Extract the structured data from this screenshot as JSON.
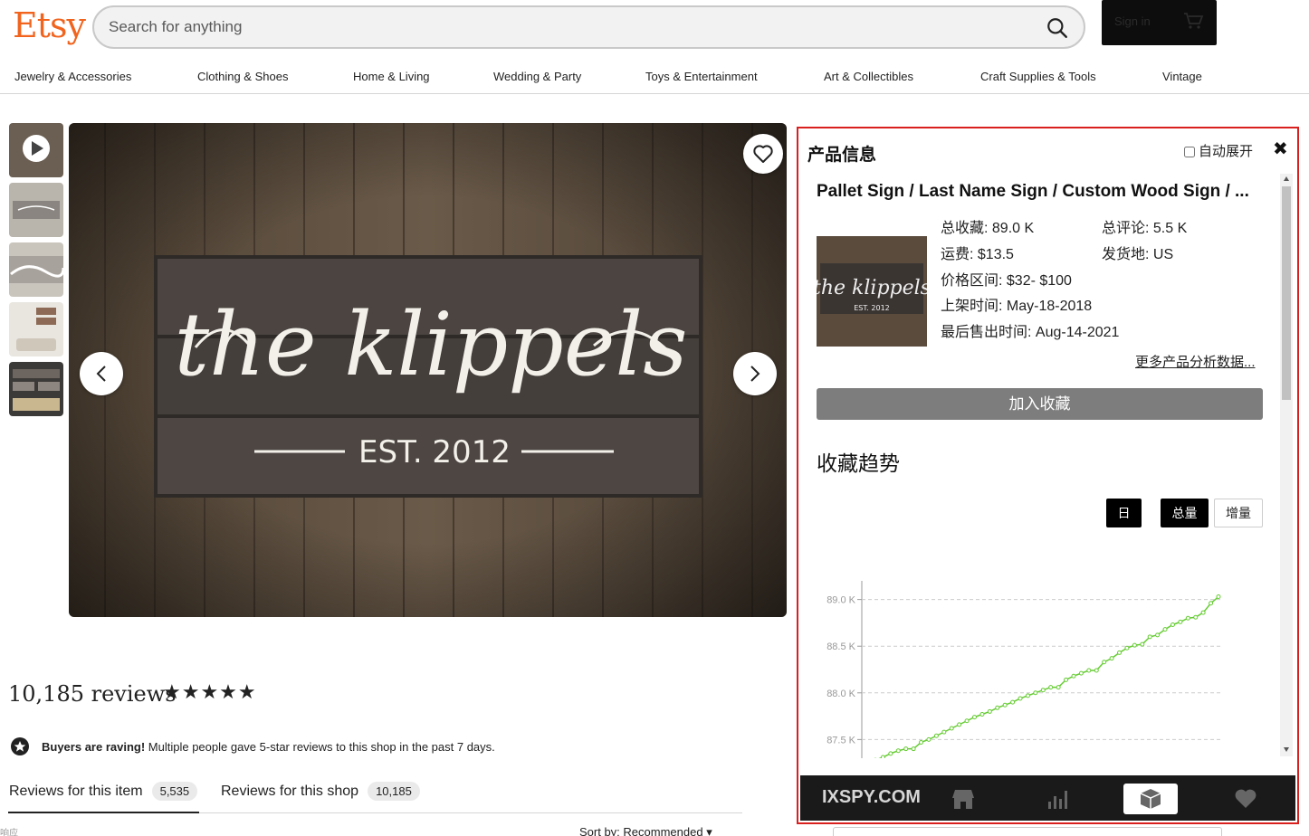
{
  "header": {
    "logo": "Etsy",
    "search_placeholder": "Search for anything",
    "sign_in": "Sign in"
  },
  "categories": [
    "Jewelry & Accessories",
    "Clothing & Shoes",
    "Home & Living",
    "Wedding & Party",
    "Toys & Entertainment",
    "Art & Collectibles",
    "Craft Supplies & Tools",
    "Vintage"
  ],
  "image": {
    "sign_script": "the klippels",
    "sign_est": "EST. 2012"
  },
  "reviews": {
    "count_label": "10,185 reviews",
    "stars": "★★★★★",
    "raving_bold": "Buyers are raving!",
    "raving_text": " Multiple people gave 5-star reviews to this shop in the past 7 days.",
    "tab_item": "Reviews for this item",
    "tab_item_count": "5,535",
    "tab_shop": "Reviews for this shop",
    "tab_shop_count": "10,185",
    "sort": "Sort by: Recommended"
  },
  "panel": {
    "title": "产品信息",
    "auto_expand": "自动展开",
    "close": "✖",
    "product_title": "Pallet Sign / Last Name Sign / Custom Wood Sign / ...",
    "thumb_script": "the klippels",
    "thumb_est": "EST. 2012",
    "stats": {
      "total_fav": "总收藏: 89.0 K",
      "total_reviews": "总评论: 5.5 K",
      "shipping": "运费: $13.5",
      "ship_from": "发货地: US",
      "price_range": "价格区间: $32- $100",
      "listed": "上架时间: May-18-2018",
      "last_sold": "最后售出时间: Aug-14-2021"
    },
    "more_link": "更多产品分析数据...",
    "add_fav": "加入收藏",
    "trend_title": "收藏趋势",
    "btn_day": "日",
    "btn_total": "总量",
    "btn_increment": "增量",
    "brand": "IXSPY.COM"
  },
  "chart_data": {
    "type": "line",
    "title": "",
    "xlabel": "",
    "ylabel": "",
    "ylim": [
      87.3,
      89.2
    ],
    "yticks": [
      "89.0 K",
      "88.5 K",
      "88.0 K",
      "87.5 K"
    ],
    "ytick_values": [
      89.0,
      88.5,
      88.0,
      87.5
    ],
    "series_color": "#66cc33",
    "values": [
      87.28,
      87.31,
      87.35,
      87.38,
      87.4,
      87.4,
      87.47,
      87.5,
      87.54,
      87.58,
      87.62,
      87.66,
      87.7,
      87.74,
      87.77,
      87.8,
      87.84,
      87.87,
      87.9,
      87.94,
      87.97,
      88.0,
      88.03,
      88.06,
      88.06,
      88.14,
      88.18,
      88.21,
      88.24,
      88.24,
      88.33,
      88.37,
      88.43,
      88.48,
      88.51,
      88.52,
      88.6,
      88.62,
      88.68,
      88.73,
      88.76,
      88.8,
      88.81,
      88.86,
      88.96,
      89.03
    ]
  }
}
